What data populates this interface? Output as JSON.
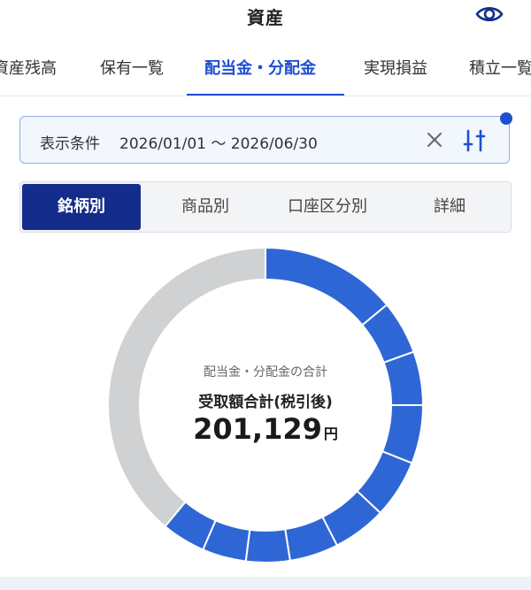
{
  "header": {
    "title": "資産"
  },
  "tabs": [
    {
      "label": "資産残高",
      "active": false
    },
    {
      "label": "保有一覧",
      "active": false
    },
    {
      "label": "配当金・分配金",
      "active": true
    },
    {
      "label": "実現損益",
      "active": false
    },
    {
      "label": "積立一覧",
      "active": false
    }
  ],
  "filter": {
    "label": "表示条件",
    "value": "2026/01/01 〜 2026/06/30"
  },
  "segments": [
    {
      "label": "銘柄別",
      "active": true
    },
    {
      "label": "商品別",
      "active": false
    },
    {
      "label": "口座区分別",
      "active": false
    },
    {
      "label": "詳細",
      "active": false
    }
  ],
  "summary": {
    "caption": "配当金・分配金の合計",
    "label": "受取額合計(税引後)",
    "amount": "201,129",
    "unit": "円"
  },
  "chart_data": {
    "type": "pie",
    "values": [
      14,
      5.5,
      5.5,
      6,
      6,
      5.5,
      5,
      4.5,
      4.5,
      4.5,
      39
    ],
    "colors": [
      "#2f66d6",
      "#2f66d6",
      "#2f66d6",
      "#2f66d6",
      "#2f66d6",
      "#2f66d6",
      "#2f66d6",
      "#2f66d6",
      "#2f66d6",
      "#2f66d6",
      "#d0d1d3"
    ]
  },
  "colors": {
    "accent": "#1e4fd0",
    "segment_active": "#142d8a"
  }
}
